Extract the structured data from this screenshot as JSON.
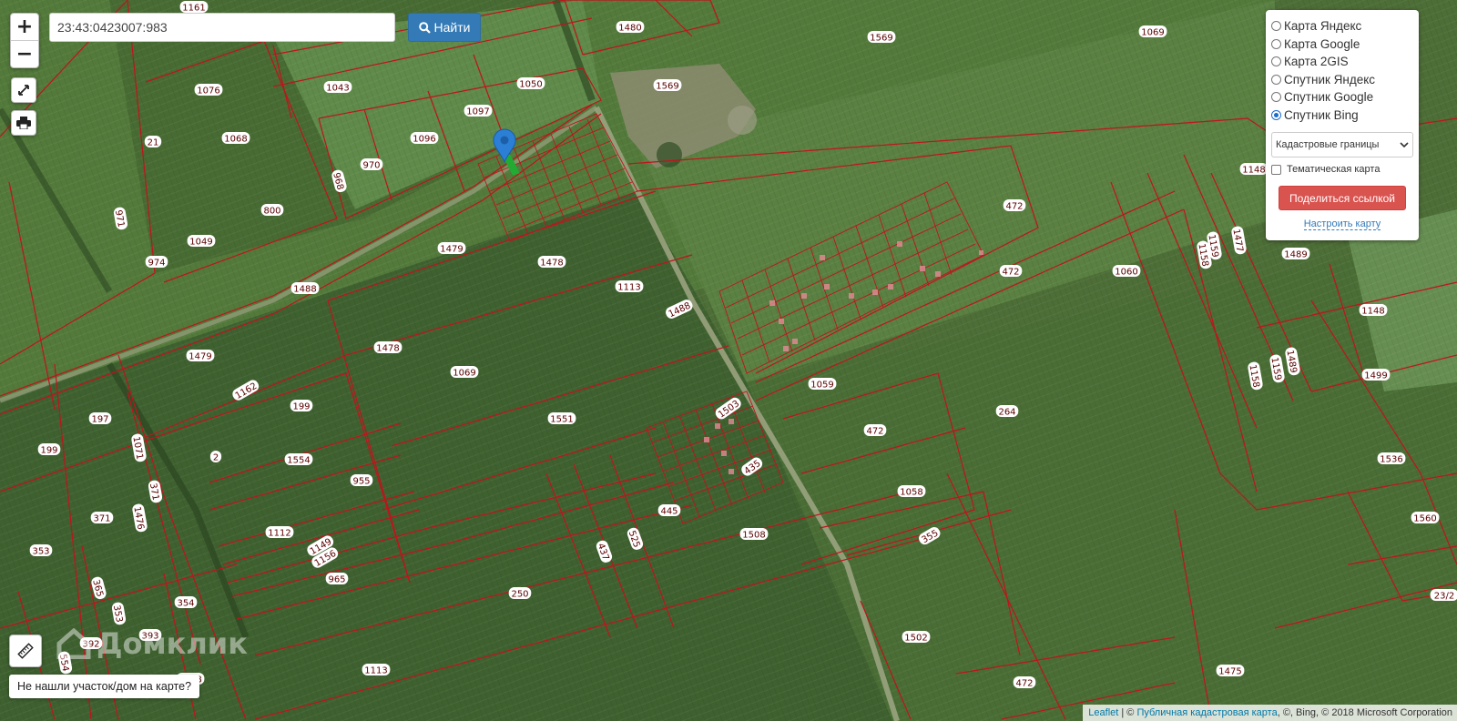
{
  "search": {
    "value": "23:43:0423007:983",
    "button_label": "Найти"
  },
  "zoom": {
    "plus": "+",
    "minus": "−"
  },
  "icons": {
    "fullscreen": "fullscreen-icon",
    "print": "printer-icon",
    "ruler": "ruler-icon",
    "search": "search-icon",
    "marker": "map-marker-icon"
  },
  "layers": {
    "items": [
      {
        "label": "Карта Яндекс",
        "selected": false
      },
      {
        "label": "Карта Google",
        "selected": false
      },
      {
        "label": "Карта 2GIS",
        "selected": false
      },
      {
        "label": "Спутник Яндекс",
        "selected": false
      },
      {
        "label": "Спутник Google",
        "selected": false
      },
      {
        "label": "Спутник Bing",
        "selected": true
      }
    ],
    "overlay_select": "Кадастровые границы",
    "thematic_label": "Тематическая карта",
    "thematic_checked": false,
    "share_label": "Поделиться ссылкой",
    "configure_label": "Настроить карту"
  },
  "watermark": "Домклик",
  "not_found_label": "Не нашли участок/дом на карте?",
  "attribution": {
    "leaflet": "Leaflet",
    "sep": " | © ",
    "cadastral": "Публичная кадастровая карта",
    "rest": ", ©, Bing, © 2018 Microsoft Corporation"
  },
  "colors": {
    "boundary": "#c0141c",
    "highlight": "#22aa33",
    "button_primary": "#337ab7",
    "button_danger": "#d9534f",
    "field_dark": "#3f6130",
    "field_light": "#5c8040"
  },
  "parcels": [
    "1161",
    "1043",
    "1076",
    "21",
    "1068",
    "800",
    "971",
    "1049",
    "974",
    "968",
    "970",
    "1096",
    "1097",
    "1050",
    "1480",
    "1569",
    "1569",
    "1069",
    "1479",
    "1478",
    "1113",
    "1488",
    "1488",
    "1479",
    "1478",
    "1069",
    "1162",
    "199",
    "197",
    "199",
    "1071",
    "2",
    "1554",
    "955",
    "371",
    "371",
    "1476",
    "1112",
    "1149",
    "1156",
    "965",
    "365",
    "353",
    "354",
    "353",
    "393",
    "392",
    "554",
    "1048",
    "1113",
    "1551",
    "1503",
    "435",
    "445",
    "525",
    "437",
    "1508",
    "250",
    "1059",
    "472",
    "472",
    "264",
    "472",
    "1060",
    "1058",
    "355",
    "1502",
    "472",
    "1475",
    "1148",
    "1158",
    "1159",
    "1477",
    "1489",
    "1148",
    "1158",
    "1159",
    "1489",
    "1499",
    "1536",
    "1560",
    "23/2"
  ]
}
